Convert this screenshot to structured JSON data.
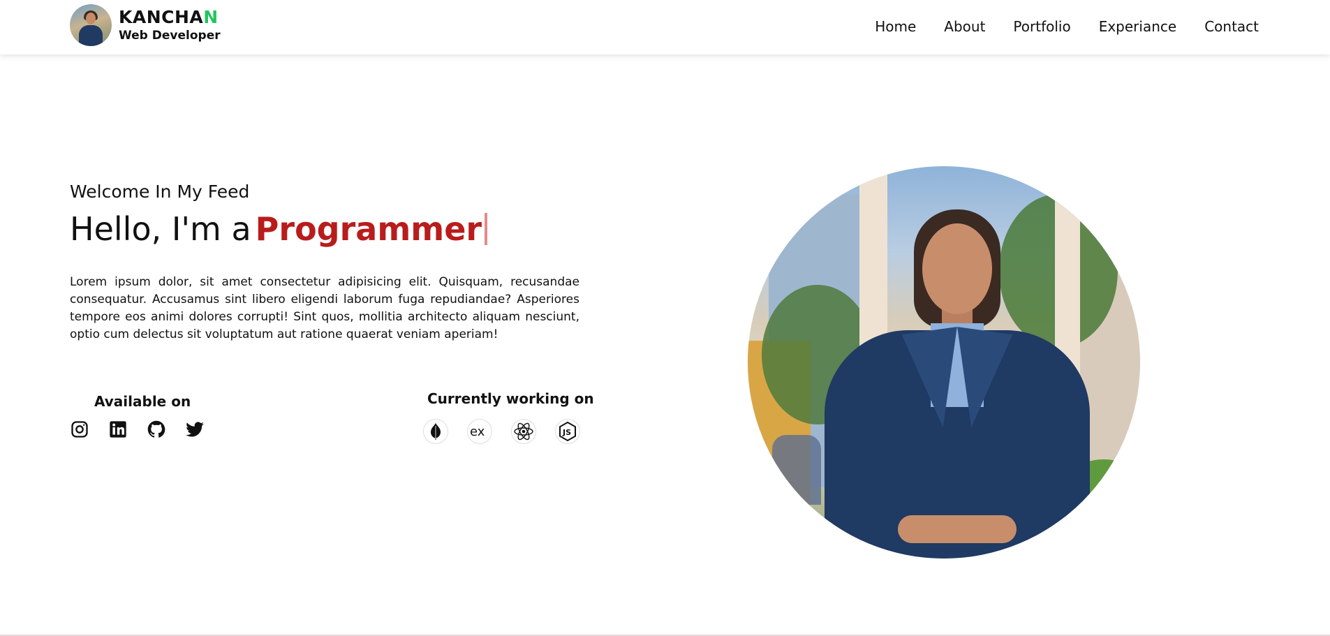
{
  "brand": {
    "name_main": "KANCHA",
    "name_accent": "N",
    "subtitle": "Web Developer",
    "accent_color": "#22c55e"
  },
  "nav": {
    "items": [
      {
        "label": "Home"
      },
      {
        "label": "About"
      },
      {
        "label": "Portfolio"
      },
      {
        "label": "Experiance"
      },
      {
        "label": "Contact"
      }
    ]
  },
  "hero": {
    "welcome": "Welcome In My Feed",
    "greeting": "Hello, I'm a",
    "role": "Programmer",
    "role_color": "#b91c1c",
    "description": "Lorem ipsum dolor, sit amet consectetur adipisicing elit. Quisquam, recusandae consequatur. Accusamus sint libero eligendi laborum fuga repudiandae? Asperiores tempore eos animi dolores corrupti! Sint quos, mollitia architecto aliquam nesciunt, optio cum delectus sit voluptatum aut ratione quaerat veniam aperiam!"
  },
  "available": {
    "title": "Available on",
    "icons": [
      "instagram-icon",
      "linkedin-icon",
      "github-icon",
      "twitter-icon"
    ]
  },
  "working": {
    "title": "Currently working on",
    "icons": [
      "mongodb-icon",
      "express-icon",
      "react-icon",
      "nodejs-icon"
    ]
  }
}
